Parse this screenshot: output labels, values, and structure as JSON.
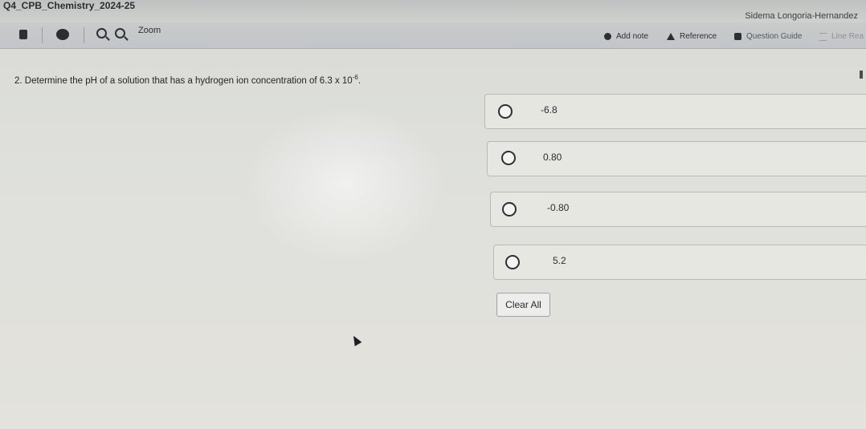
{
  "window": {
    "title": "Q4_CPB_Chemistry_2024-25",
    "student_name": "Sidema Longoria-Hernandez"
  },
  "toolbar": {
    "zoom_label": "Zoom",
    "add_note_label": "Add note",
    "reference_label": "Reference",
    "question_guide_label": "Question Guide",
    "line_reader_label": "Line Rea"
  },
  "question": {
    "number": "2.",
    "text": "Determine the pH of a solution that has a hydrogen ion concentration of",
    "value_base": "6.3 x 10",
    "value_exponent": "-6",
    "value_end": "."
  },
  "choices": [
    {
      "label": "-6.8",
      "selected": false
    },
    {
      "label": "0.80",
      "selected": false
    },
    {
      "label": "-0.80",
      "selected": false
    },
    {
      "label": "5.2",
      "selected": false
    }
  ],
  "clear_all_label": "Clear All"
}
